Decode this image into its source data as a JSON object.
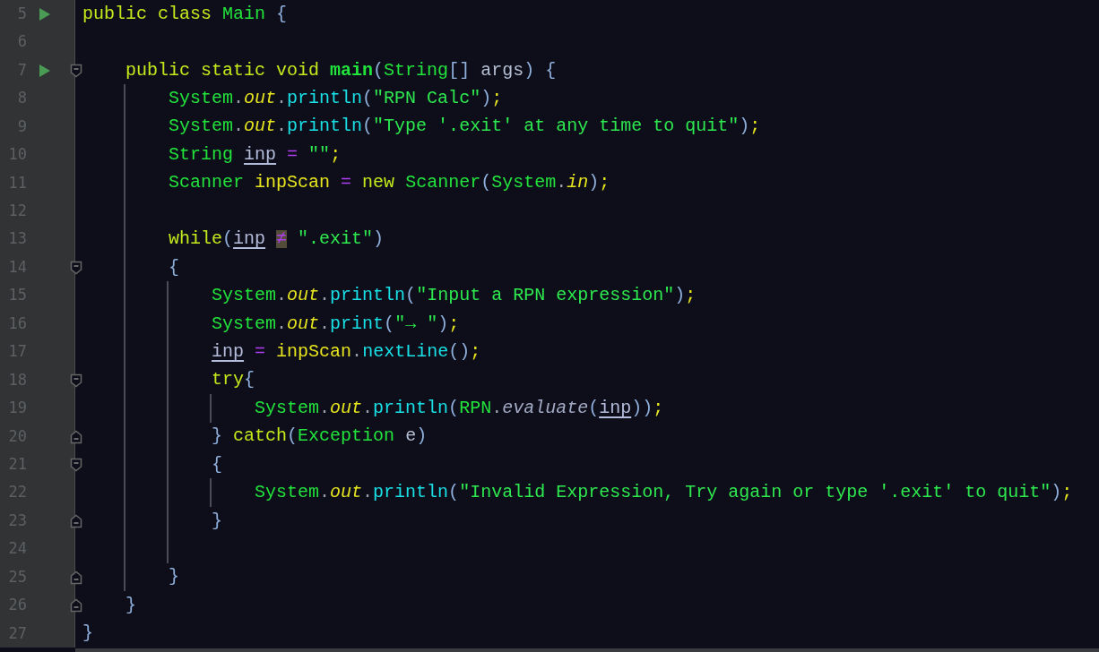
{
  "editor": {
    "lines": [
      {
        "number": "5",
        "run": true,
        "fold_start": false,
        "fold_end": false,
        "tokens": [
          {
            "text": "public class ",
            "kind": "keyword"
          },
          {
            "text": "Main ",
            "kind": "type"
          },
          {
            "text": "{",
            "kind": "punct"
          }
        ]
      },
      {
        "number": "6",
        "run": false,
        "fold_start": false,
        "fold_end": false
      },
      {
        "number": "7",
        "run": true,
        "fold_start": true,
        "fold_end": false,
        "tokens": [
          {
            "text": "    public static void ",
            "kind": "keyword"
          },
          {
            "text": "main",
            "kind": "declaration"
          },
          {
            "text": "(",
            "kind": "punct"
          },
          {
            "text": "String",
            "kind": "type"
          },
          {
            "text": "[] ",
            "kind": "punct"
          },
          {
            "text": "args",
            "kind": "param"
          },
          {
            "text": ") {",
            "kind": "punct"
          }
        ]
      },
      {
        "number": "8",
        "run": false,
        "fold_start": false,
        "fold_end": false,
        "tokens": [
          {
            "text": "        System",
            "kind": "type"
          },
          {
            "text": ".",
            "kind": "dot"
          },
          {
            "text": "out",
            "kind": "field"
          },
          {
            "text": ".",
            "kind": "dot"
          },
          {
            "text": "println",
            "kind": "method"
          },
          {
            "text": "(",
            "kind": "punct"
          },
          {
            "text": "\"RPN Calc\"",
            "kind": "string"
          },
          {
            "text": ")",
            "kind": "punct"
          },
          {
            "text": ";",
            "kind": "semi"
          }
        ]
      },
      {
        "number": "9",
        "run": false,
        "fold_start": false,
        "fold_end": false,
        "tokens": [
          {
            "text": "        System",
            "kind": "type"
          },
          {
            "text": ".",
            "kind": "dot"
          },
          {
            "text": "out",
            "kind": "field"
          },
          {
            "text": ".",
            "kind": "dot"
          },
          {
            "text": "println",
            "kind": "method"
          },
          {
            "text": "(",
            "kind": "punct"
          },
          {
            "text": "\"Type '.exit' at any time to quit\"",
            "kind": "string"
          },
          {
            "text": ")",
            "kind": "punct"
          },
          {
            "text": ";",
            "kind": "semi"
          }
        ]
      },
      {
        "number": "10",
        "run": false,
        "fold_start": false,
        "fold_end": false,
        "tokens": [
          {
            "text": "        String ",
            "kind": "type"
          },
          {
            "text": "inp",
            "kind": "reassigned"
          },
          {
            "text": " = ",
            "kind": "operator"
          },
          {
            "text": "\"\"",
            "kind": "string"
          },
          {
            "text": ";",
            "kind": "semi"
          }
        ]
      },
      {
        "number": "11",
        "run": false,
        "fold_start": false,
        "fold_end": false,
        "tokens": [
          {
            "text": "        Scanner ",
            "kind": "type"
          },
          {
            "text": "inpScan ",
            "kind": "local"
          },
          {
            "text": "= ",
            "kind": "operator"
          },
          {
            "text": "new ",
            "kind": "keyword"
          },
          {
            "text": "Scanner",
            "kind": "type"
          },
          {
            "text": "(",
            "kind": "punct"
          },
          {
            "text": "System",
            "kind": "type"
          },
          {
            "text": ".",
            "kind": "dot"
          },
          {
            "text": "in",
            "kind": "field"
          },
          {
            "text": ")",
            "kind": "punct"
          },
          {
            "text": ";",
            "kind": "semi"
          }
        ]
      },
      {
        "number": "12",
        "run": false,
        "fold_start": false,
        "fold_end": false
      },
      {
        "number": "13",
        "run": false,
        "fold_start": false,
        "fold_end": false,
        "tokens": [
          {
            "text": "        while",
            "kind": "keyword"
          },
          {
            "text": "(",
            "kind": "punct"
          },
          {
            "text": "inp",
            "kind": "reassigned"
          },
          {
            "text": "≠",
            "kind": "highlighted-operator"
          },
          {
            "text": " \".exit\"",
            "kind": "string"
          },
          {
            "text": ")",
            "kind": "punct"
          }
        ]
      },
      {
        "number": "14",
        "run": false,
        "fold_start": true,
        "fold_end": false,
        "tokens": [
          {
            "text": "        {",
            "kind": "punct"
          }
        ]
      },
      {
        "number": "15",
        "run": false,
        "fold_start": false,
        "fold_end": false,
        "tokens": [
          {
            "text": "            System",
            "kind": "type"
          },
          {
            "text": ".",
            "kind": "dot"
          },
          {
            "text": "out",
            "kind": "field"
          },
          {
            "text": ".",
            "kind": "dot"
          },
          {
            "text": "println",
            "kind": "method"
          },
          {
            "text": "(",
            "kind": "punct"
          },
          {
            "text": "\"Input a RPN expression\"",
            "kind": "string"
          },
          {
            "text": ")",
            "kind": "punct"
          },
          {
            "text": ";",
            "kind": "semi"
          }
        ]
      },
      {
        "number": "16",
        "run": false,
        "fold_start": false,
        "fold_end": false,
        "tokens": [
          {
            "text": "            System",
            "kind": "type"
          },
          {
            "text": ".",
            "kind": "dot"
          },
          {
            "text": "out",
            "kind": "field"
          },
          {
            "text": ".",
            "kind": "dot"
          },
          {
            "text": "print",
            "kind": "method"
          },
          {
            "text": "(",
            "kind": "punct"
          },
          {
            "text": "\"→ \"",
            "kind": "string"
          },
          {
            "text": ")",
            "kind": "punct"
          },
          {
            "text": ";",
            "kind": "semi"
          }
        ]
      },
      {
        "number": "17",
        "run": false,
        "fold_start": false,
        "fold_end": false,
        "tokens": [
          {
            "text": "            inp",
            "kind": "reassigned"
          },
          {
            "text": " = ",
            "kind": "operator"
          },
          {
            "text": "inpScan",
            "kind": "local"
          },
          {
            "text": ".",
            "kind": "dot"
          },
          {
            "text": "nextLine",
            "kind": "method"
          },
          {
            "text": "()",
            "kind": "punct"
          },
          {
            "text": ";",
            "kind": "semi"
          }
        ]
      },
      {
        "number": "18",
        "run": false,
        "fold_start": true,
        "fold_end": false,
        "tokens": [
          {
            "text": "            try",
            "kind": "keyword"
          },
          {
            "text": "{",
            "kind": "punct"
          }
        ]
      },
      {
        "number": "19",
        "run": false,
        "fold_start": false,
        "fold_end": false,
        "tokens": [
          {
            "text": "                System",
            "kind": "type"
          },
          {
            "text": ".",
            "kind": "dot"
          },
          {
            "text": "out",
            "kind": "field"
          },
          {
            "text": ".",
            "kind": "dot"
          },
          {
            "text": "println",
            "kind": "method"
          },
          {
            "text": "(",
            "kind": "punct"
          },
          {
            "text": "RPN",
            "kind": "type"
          },
          {
            "text": ".",
            "kind": "dot"
          },
          {
            "text": "evaluate",
            "kind": "static-method"
          },
          {
            "text": "(",
            "kind": "punct"
          },
          {
            "text": "inp",
            "kind": "reassigned"
          },
          {
            "text": "))",
            "kind": "punct"
          },
          {
            "text": ";",
            "kind": "semi"
          }
        ]
      },
      {
        "number": "20",
        "run": false,
        "fold_start": false,
        "fold_end": true,
        "tokens": [
          {
            "text": "            } ",
            "kind": "punct"
          },
          {
            "text": "catch",
            "kind": "keyword"
          },
          {
            "text": "(",
            "kind": "punct"
          },
          {
            "text": "Exception ",
            "kind": "type"
          },
          {
            "text": "e",
            "kind": "param"
          },
          {
            "text": ")",
            "kind": "punct"
          }
        ]
      },
      {
        "number": "21",
        "run": false,
        "fold_start": true,
        "fold_end": false,
        "tokens": [
          {
            "text": "            {",
            "kind": "punct"
          }
        ]
      },
      {
        "number": "22",
        "run": false,
        "fold_start": false,
        "fold_end": false,
        "tokens": [
          {
            "text": "                System",
            "kind": "type"
          },
          {
            "text": ".",
            "kind": "dot"
          },
          {
            "text": "out",
            "kind": "field"
          },
          {
            "text": ".",
            "kind": "dot"
          },
          {
            "text": "println",
            "kind": "method"
          },
          {
            "text": "(",
            "kind": "punct"
          },
          {
            "text": "\"Invalid Expression, Try again or type '.exit' to quit\"",
            "kind": "string"
          },
          {
            "text": ")",
            "kind": "punct"
          },
          {
            "text": ";",
            "kind": "semi"
          }
        ]
      },
      {
        "number": "23",
        "run": false,
        "fold_start": false,
        "fold_end": true,
        "tokens": [
          {
            "text": "            }",
            "kind": "punct"
          }
        ]
      },
      {
        "number": "24",
        "run": false,
        "fold_start": false,
        "fold_end": false
      },
      {
        "number": "25",
        "run": false,
        "fold_start": false,
        "fold_end": true,
        "tokens": [
          {
            "text": "        }",
            "kind": "punct"
          }
        ]
      },
      {
        "number": "26",
        "run": false,
        "fold_start": false,
        "fold_end": true,
        "tokens": [
          {
            "text": "    }",
            "kind": "punct"
          }
        ]
      },
      {
        "number": "27",
        "run": false,
        "fold_start": false,
        "fold_end": false,
        "tokens": [
          {
            "text": "}",
            "kind": "punct"
          }
        ]
      }
    ]
  }
}
